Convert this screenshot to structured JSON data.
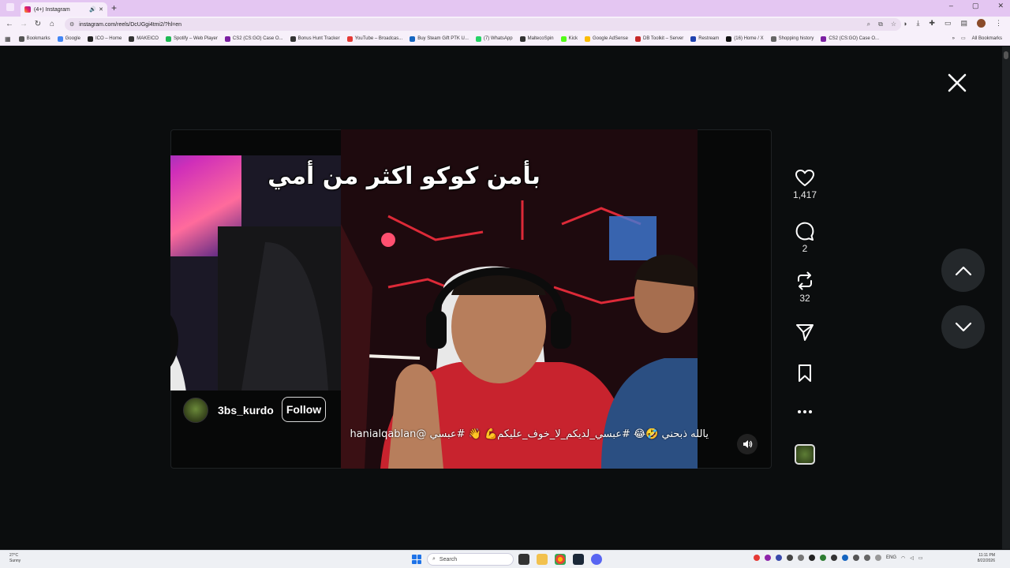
{
  "browser": {
    "tab_title": "(4+) Instagram",
    "new_tab": "+",
    "url": "instagram.com/reels/DcUGgi4tmi2/?hl=en",
    "window_controls": [
      "–",
      "▢",
      "✕"
    ],
    "bookmarks": [
      {
        "label": "Bookmarks",
        "color": "#555"
      },
      {
        "label": "Google",
        "color": "#4285f4"
      },
      {
        "label": "ICO – Home",
        "color": "#222"
      },
      {
        "label": "MAKEICO",
        "color": "#333"
      },
      {
        "label": "Spotify – Web Player",
        "color": "#1db954"
      },
      {
        "label": "CS2 (CS:GO) Case O...",
        "color": "#7b1fa2"
      },
      {
        "label": "Bonus Hunt Tracker",
        "color": "#333"
      },
      {
        "label": "YouTube – Broadcas...",
        "color": "#e53935"
      },
      {
        "label": "Buy Steam Gift PTK U...",
        "color": "#1565c0"
      },
      {
        "label": "(7) WhatsApp",
        "color": "#25d366"
      },
      {
        "label": "MaltecoSpin",
        "color": "#333"
      },
      {
        "label": "Kick",
        "color": "#53fc18"
      },
      {
        "label": "Google AdSense",
        "color": "#fbbc04"
      },
      {
        "label": "DB Toolkit – Server",
        "color": "#c62828"
      },
      {
        "label": "Restream",
        "color": "#1e40af"
      },
      {
        "label": "(16) Home / X",
        "color": "#111"
      },
      {
        "label": "Shopping history",
        "color": "#666"
      },
      {
        "label": "CS2 (CS:GO) Case O...",
        "color": "#7b1fa2"
      }
    ],
    "all_bookmarks": "All Bookmarks"
  },
  "reel": {
    "subtitle": "بأمن كوكو اكثر من أمي",
    "author": "3bs_kurdo",
    "follow_label": "Follow",
    "caption": "يالله ذبحني 🤣😂 #عبسي_لديكم_لا_خوف_عليكم💪 👋 #عبسي @hanialqablan",
    "likes": "1,417",
    "comments": "2",
    "reposts": "32"
  },
  "taskbar": {
    "weather_temp": "27°C",
    "weather_desc": "Sunny",
    "search_placeholder": "Search",
    "lang": "ENG",
    "time": "11:11 PM",
    "date": "8/22/2026"
  },
  "colors": {
    "tabbar": "#e4c6f2",
    "toolbar": "#f7f0fa",
    "page_bg": "#0b0d0e",
    "nav_circle": "#24282b",
    "accent_start": "#1e73e8"
  }
}
